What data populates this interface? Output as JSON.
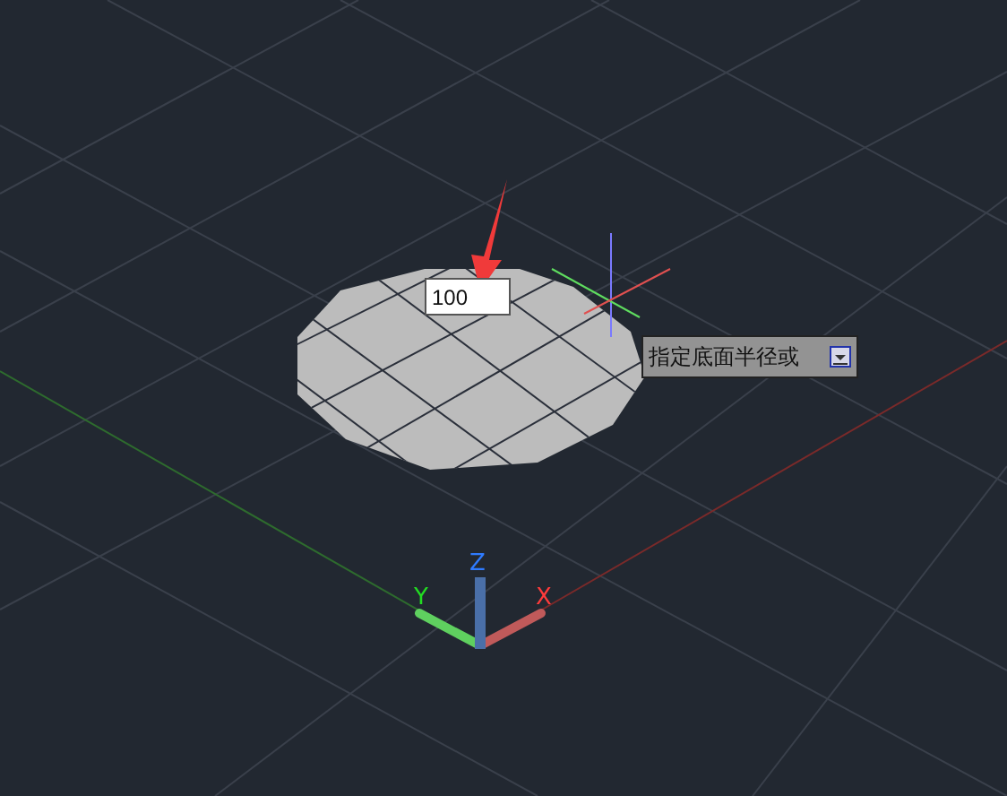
{
  "viewport": {
    "dynamic_input": {
      "value": "100"
    },
    "tooltip": {
      "text": "指定底面半径或"
    },
    "axes": [
      {
        "label": "Z",
        "color": "#2f7bff"
      },
      {
        "label": "Y",
        "color": "#22dd22"
      },
      {
        "label": "X",
        "color": "#ff3b3b"
      }
    ]
  }
}
